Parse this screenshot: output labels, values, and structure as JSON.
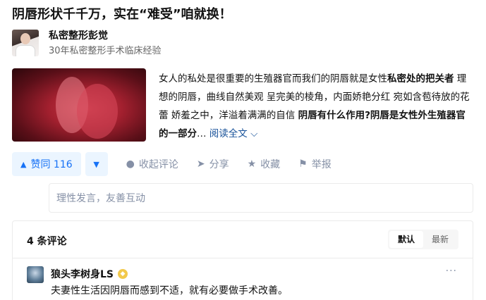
{
  "article": {
    "title": "阴唇形状千千万，实在“难受”咱就换！"
  },
  "author": {
    "name": "私密整形彭觉",
    "description": "30年私密整形手术临床经验"
  },
  "excerpt": {
    "part1": "女人的私处是很重要的生殖器官而我们的阴唇就是女性",
    "bold1": "私密处的把关者",
    "part2": " 理想的阴唇，曲线自然美观 呈完美的棱角，内面娇艳分红 宛如含苞待放的花蕾 娇羞之中，洋溢着满满的自信 ",
    "bold2": "阴唇有什么作用?阴唇是女性外生殖器官的一部分",
    "ellipsis": "… ",
    "read_more": "阅读全文"
  },
  "actions": {
    "vote_up_label": "赞同 116",
    "collapse_comments": "收起评论",
    "share": "分享",
    "favorite": "收藏",
    "report": "举报"
  },
  "comment_box": {
    "placeholder": "理性发言，友善互动"
  },
  "comments": {
    "count_label": "4 条评论",
    "sort_default": "默认",
    "sort_latest": "最新",
    "items": [
      {
        "user": "狼头李树身LS",
        "text": "夫妻性生活因阴唇而感到不适，就有必要做手术改善。"
      }
    ]
  },
  "colors": {
    "accent": "#1772f6",
    "accent_bg": "#ebf5ff",
    "muted": "#8590a6",
    "link": "#175199"
  }
}
